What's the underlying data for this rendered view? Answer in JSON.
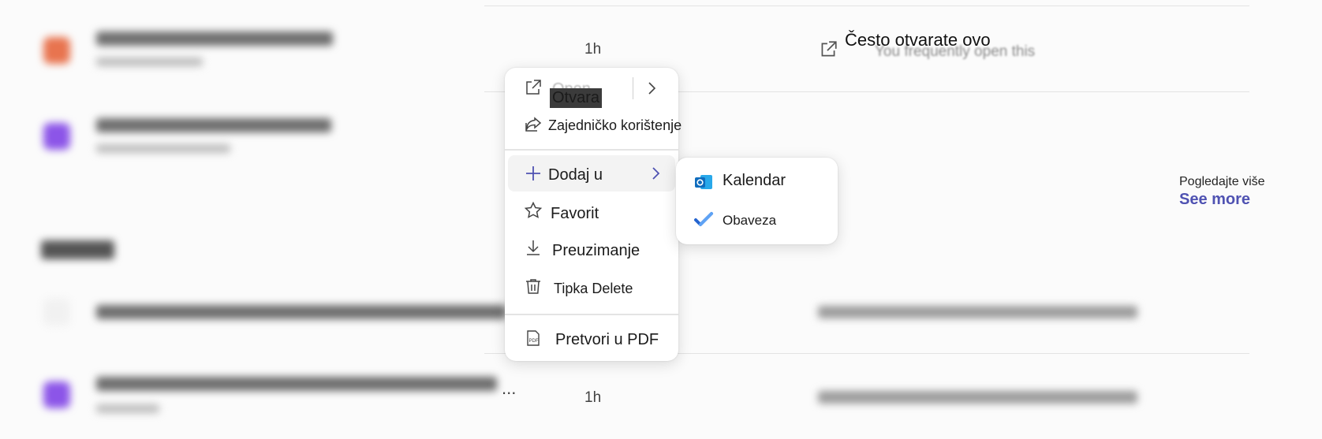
{
  "background": {
    "rows": [
      {
        "time": "1h"
      },
      {
        "time": ""
      },
      {
        "time": ""
      },
      {
        "time": "1h"
      }
    ],
    "truncation": "...",
    "frequent": {
      "title": "Često otvarate ovo",
      "original": "You frequently open this"
    },
    "see_more": {
      "translated": "Pogledajte više",
      "label": "See more"
    }
  },
  "context_menu": {
    "open": {
      "ghost": "Open",
      "label": "Otvara"
    },
    "share": {
      "label": "Zajedničko korištenje"
    },
    "add_to": {
      "label": "Dodaj u"
    },
    "favorite": {
      "label": "Favorit"
    },
    "download": {
      "label": "Preuzimanje"
    },
    "delete": {
      "label": "Tipka Delete"
    },
    "convert": {
      "label": "Pretvori u PDF"
    }
  },
  "submenu": {
    "calendar": {
      "label": "Kalendar"
    },
    "task": {
      "label": "Obaveza"
    }
  },
  "colors": {
    "accent": "#4f52b2",
    "outlook_blue": "#0f6cbd",
    "todo_blue": "#2564cf"
  }
}
